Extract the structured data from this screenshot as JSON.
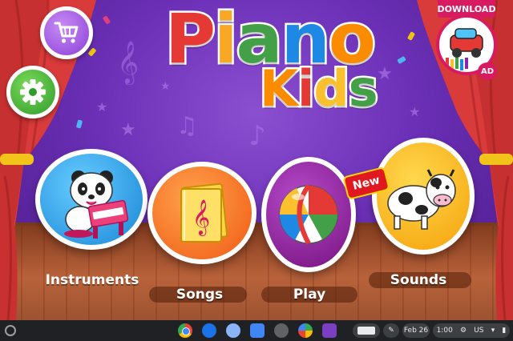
{
  "app": {
    "title_word_1": "Piano",
    "title_word_2": "Kids"
  },
  "top_left": {
    "shop_icon": "cart-icon",
    "settings_icon": "gear-icon"
  },
  "ad": {
    "badge": "DOWNLOAD",
    "tag": "AD"
  },
  "menu": {
    "new_badge": "New",
    "items": [
      {
        "label": "Instruments",
        "icon": "panda-piano-icon",
        "color": "#1a86d6"
      },
      {
        "label": "Songs",
        "icon": "songbook-icon",
        "color": "#f05a12"
      },
      {
        "label": "Play",
        "icon": "beach-ball-icon",
        "color": "#76127e"
      },
      {
        "label": "Sounds",
        "icon": "cow-icon",
        "color": "#f5a10a"
      }
    ]
  },
  "colors": {
    "title_letters": [
      "#e53935",
      "#f9a825",
      "#43a047",
      "#1e88e5",
      "#fb8c00"
    ],
    "kids_letters": [
      "#fb8c00",
      "#e53935",
      "#fbc02d",
      "#43a047"
    ],
    "curtain": "#d93a3a",
    "background": "#6a2fb5"
  },
  "shelf": {
    "apps": [
      "chrome-icon",
      "messages-icon",
      "clock-app-icon",
      "files-icon",
      "settings-app-icon",
      "play-store-icon",
      "piano-kids-app-icon"
    ],
    "date": "Feb 26",
    "time": "1:00",
    "locale": "US"
  }
}
